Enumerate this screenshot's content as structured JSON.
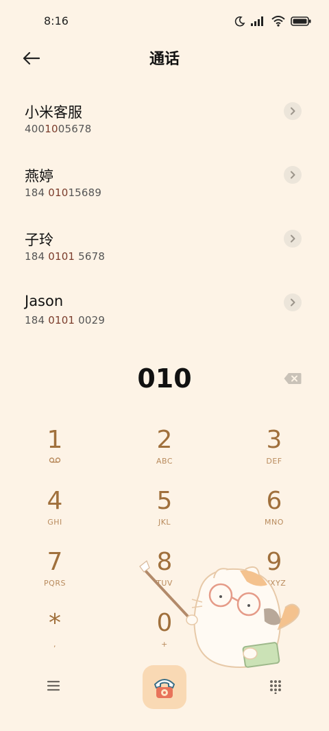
{
  "status_bar": {
    "time": "8:16",
    "icons": [
      "moon-icon",
      "signal-icon",
      "wifi-icon",
      "battery-icon"
    ]
  },
  "header": {
    "title": "通话",
    "back_icon": "arrow-left-icon"
  },
  "contacts": [
    {
      "name": "小米客服",
      "number_pre": "400",
      "number_hl": "10",
      "number_post": "05678"
    },
    {
      "name": "燕婷",
      "number_pre": "184 ",
      "number_hl": "010",
      "number_post": "15689"
    },
    {
      "name": "子玲",
      "number_pre": "184 ",
      "number_hl": "0101",
      "number_post": " 5678"
    },
    {
      "name": "Jason",
      "number_pre": "184 ",
      "number_hl": "0101",
      "number_post": " 0029"
    }
  ],
  "dial": {
    "input": "010"
  },
  "keypad": [
    {
      "digit": "1",
      "letters": "ꝏ"
    },
    {
      "digit": "2",
      "letters": "ABC"
    },
    {
      "digit": "3",
      "letters": "DEF"
    },
    {
      "digit": "4",
      "letters": "GHI"
    },
    {
      "digit": "5",
      "letters": "JKL"
    },
    {
      "digit": "6",
      "letters": "MNO"
    },
    {
      "digit": "7",
      "letters": "PQRS"
    },
    {
      "digit": "8",
      "letters": "TUV"
    },
    {
      "digit": "9",
      "letters": "WXYZ"
    },
    {
      "digit": "*",
      "letters": ","
    },
    {
      "digit": "0",
      "letters": "+"
    },
    {
      "digit": "#",
      "letters": ""
    }
  ],
  "colors": {
    "background": "#fdf3e6",
    "key_digit": "#a0703c",
    "key_letters": "#b88a5c",
    "highlight": "#7a3b2a",
    "call_button": "#f9d9b4",
    "call_icon": "#e8735a"
  }
}
